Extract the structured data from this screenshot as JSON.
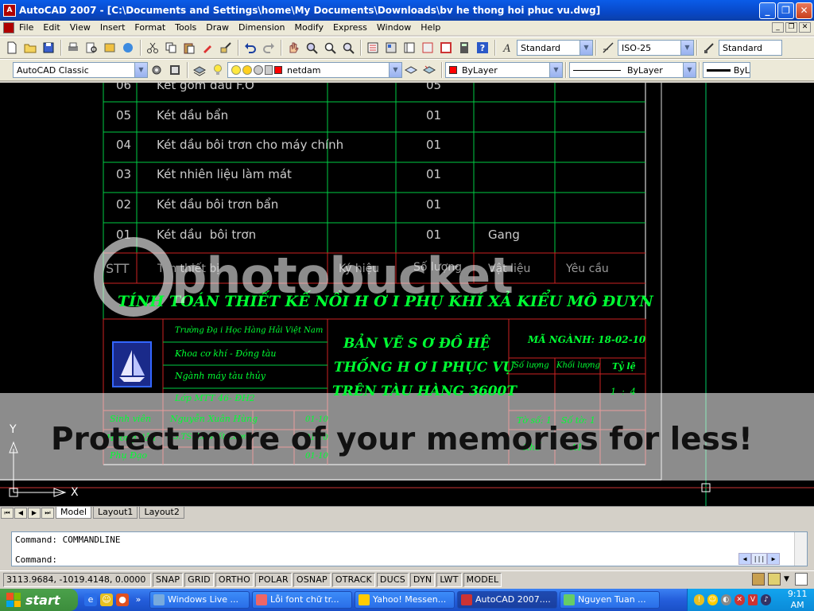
{
  "titlebar": {
    "title": "AutoCAD 2007 - [C:\\Documents and Settings\\home\\My Documents\\Downloads\\bv he thong hoi phuc vu.dwg]"
  },
  "menu": [
    "File",
    "Edit",
    "View",
    "Insert",
    "Format",
    "Tools",
    "Draw",
    "Dimension",
    "Modify",
    "Express",
    "Window",
    "Help"
  ],
  "toolbar1": {
    "text_style": "Standard",
    "dim_style": "ISO-25",
    "table_style": "Standard"
  },
  "toolbar2": {
    "workspace": "AutoCAD Classic",
    "layer": "netdam",
    "color": "ByLayer",
    "linetype": "ByLayer",
    "lineweight": "ByL"
  },
  "drawing": {
    "rows": [
      {
        "stt": "06",
        "name": "Két gom dầu F.O",
        "qty": "05",
        "mat": ""
      },
      {
        "stt": "05",
        "name": "Két dầu bẩn",
        "qty": "01",
        "mat": ""
      },
      {
        "stt": "04",
        "name": "Két dầu bôi trơn cho máy chính",
        "qty": "01",
        "mat": ""
      },
      {
        "stt": "03",
        "name": "Két nhiên liệu làm mát",
        "qty": "01",
        "mat": ""
      },
      {
        "stt": "02",
        "name": "Két dầu bôi trơn bẩn",
        "qty": "01",
        "mat": ""
      },
      {
        "stt": "01",
        "name": "Két dầu  bôi trơn",
        "qty": "01",
        "mat": "Gang"
      }
    ],
    "header": {
      "stt": "STT",
      "name": "Tên thiết bị",
      "code": "Ký hiệu",
      "qty": "Số lượng",
      "mat": "Vật liệu",
      "req": "Yêu cầu"
    },
    "project_title": "TÍNH TOÁN THIẾT KẾ NỒI H Ơ I PHỤ KHÍ XẢ KIỂU MÔ ĐUYN",
    "school": [
      "Tr­ường  Đạ i Học Hàng Hải Việt Nam",
      "Khoa cơ khí - Đóng tàu",
      "Ngành máy tàu thủy",
      "Lớp MTT 46- ĐH2"
    ],
    "drawing_title": [
      "BẢN VẼ S Ơ  ĐỒ HỆ",
      "THỐNG H Ơ I PHỤC VỤ",
      "TRÊN TÀU HÀNG 3600T"
    ],
    "code_label": "MÃ NGÀNH: 18-02-10",
    "grid_labels": {
      "qty": "Số lư­ợng",
      "mass": "Khối lư­ợng",
      "scale": "Tỷ lệ",
      "scale_val": "1  :  4",
      "sheet": "Tờ số: 1",
      "sheets": "Số tờ: 1",
      "size": "Khổ",
      "size_val": "A1"
    },
    "people": [
      {
        "role": "Sinh viên",
        "name": "Nguyễn Xuân Hùng",
        "date": "01-10"
      },
      {
        "role": "H­ướng dẫn",
        "name": "GS.TS. Lê Viết L­ượng",
        "date": "01-10"
      },
      {
        "role": "Phụ Đạo",
        "name": "",
        "date": "01-10"
      }
    ],
    "watermark_logo": "photobucket",
    "watermark_text": "Protect more of your memories for less!",
    "ucs_x": "X",
    "ucs_y": "Y"
  },
  "tabs": [
    "Model",
    "Layout1",
    "Layout2"
  ],
  "command": {
    "line1": "Command: COMMANDLINE",
    "line2": "Command:"
  },
  "status": {
    "coords": "3113.9684, -1019.4148, 0.0000",
    "buttons": [
      "SNAP",
      "GRID",
      "ORTHO",
      "POLAR",
      "OSNAP",
      "OTRACK",
      "DUCS",
      "DYN",
      "LWT",
      "MODEL"
    ]
  },
  "taskbar": {
    "start": "start",
    "items": [
      "Windows Live ...",
      "Lỗi font chữ tr...",
      "Yahoo! Messen...",
      "AutoCAD 2007....",
      "Nguyen Tuan ..."
    ],
    "clock": "9:11 AM"
  }
}
